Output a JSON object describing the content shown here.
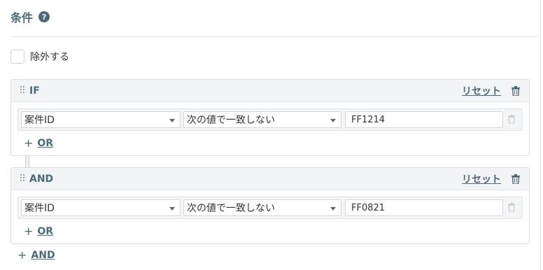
{
  "header": {
    "title": "条件",
    "help_glyph": "?"
  },
  "exclude": {
    "label": "除外する",
    "checked": false
  },
  "groups": [
    {
      "label": "IF",
      "reset_label": "リセット",
      "condition": {
        "field": "案件ID",
        "operator": "次の値で一致しない",
        "value": "FF1214"
      },
      "add_or_label": "OR"
    },
    {
      "label": "AND",
      "reset_label": "リセット",
      "condition": {
        "field": "案件ID",
        "operator": "次の値で一致しない",
        "value": "FF0821"
      },
      "add_or_label": "OR"
    }
  ],
  "add_and_label": "AND",
  "plus_glyph": "+",
  "colors": {
    "accent": "#4b6b7a",
    "group_header_bg": "#f2f4f6"
  }
}
